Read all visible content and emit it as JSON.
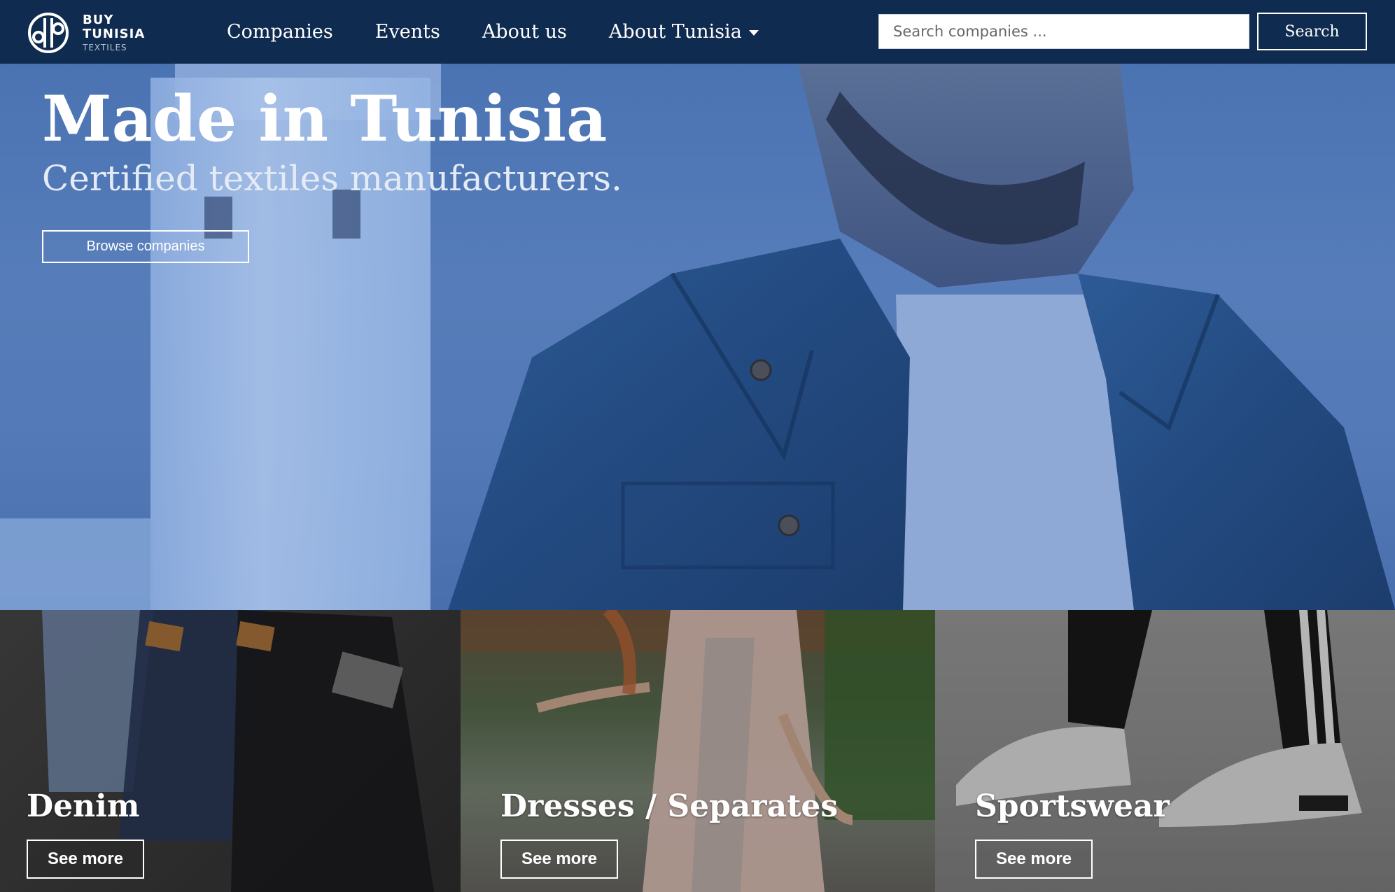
{
  "brand": {
    "line1": "BUY",
    "line2": "TUNISIA",
    "line3": "TEXTILES",
    "logo_icon": "brand-logo-icon"
  },
  "nav": {
    "links": [
      {
        "label": "Companies"
      },
      {
        "label": "Events"
      },
      {
        "label": "About us"
      },
      {
        "label": "About Tunisia",
        "dropdown": true
      }
    ]
  },
  "search": {
    "placeholder": "Search companies ...",
    "value": "",
    "button_label": "Search"
  },
  "hero": {
    "title": "Made in Tunisia",
    "subtitle": "Certified textiles manufacturers.",
    "button_label": "Browse companies"
  },
  "categories": [
    {
      "title": "Denim",
      "button_label": "See more"
    },
    {
      "title": "Dresses / Separates",
      "button_label": "See more"
    },
    {
      "title": "Sportswear",
      "button_label": "See more"
    }
  ],
  "colors": {
    "navbar": "#0f2b4f",
    "hero_tint": "#5d86c2",
    "text": "#ffffff"
  }
}
